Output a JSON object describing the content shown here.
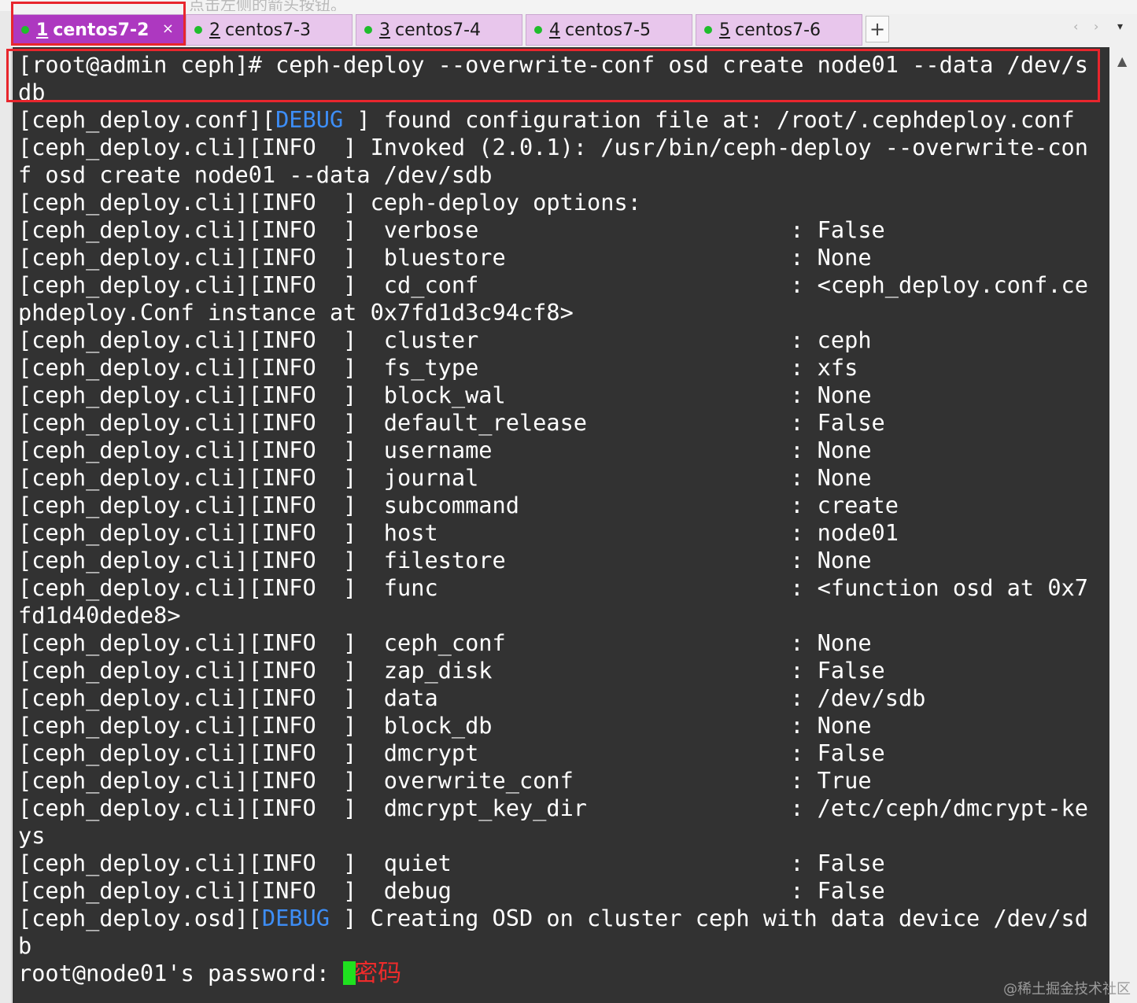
{
  "top_strip_text": "点击左侧的箭头按钮。",
  "tabs": [
    {
      "num": "1",
      "label": "centos7-2",
      "active": true
    },
    {
      "num": "2",
      "label": "centos7-3",
      "active": false
    },
    {
      "num": "3",
      "label": "centos7-4",
      "active": false
    },
    {
      "num": "4",
      "label": "centos7-5",
      "active": false
    },
    {
      "num": "5",
      "label": "centos7-6",
      "active": false
    }
  ],
  "tab_close_glyph": "×",
  "tab_add_glyph": "+",
  "nav_prev_glyph": "‹",
  "nav_next_glyph": "›",
  "menu_glyph": "▾",
  "scroll_up_glyph": "▲",
  "terminal": {
    "lines": [
      {
        "text": "[root@admin ceph]# ceph-deploy --overwrite-conf osd create node01 --data /dev/s"
      },
      {
        "text": "db"
      },
      {
        "prefix": "[ceph_deploy.conf][",
        "level": "DEBUG",
        "rest": " ] found configuration file at: /root/.cephdeploy.conf"
      },
      {
        "text": "[ceph_deploy.cli][INFO  ] Invoked (2.0.1): /usr/bin/ceph-deploy --overwrite-con"
      },
      {
        "text": "f osd create node01 --data /dev/sdb"
      },
      {
        "text": "[ceph_deploy.cli][INFO  ] ceph-deploy options:"
      },
      {
        "text": "[ceph_deploy.cli][INFO  ]  verbose                       : False"
      },
      {
        "text": "[ceph_deploy.cli][INFO  ]  bluestore                     : None"
      },
      {
        "text": "[ceph_deploy.cli][INFO  ]  cd_conf                       : <ceph_deploy.conf.ce"
      },
      {
        "text": "phdeploy.Conf instance at 0x7fd1d3c94cf8>"
      },
      {
        "text": "[ceph_deploy.cli][INFO  ]  cluster                       : ceph"
      },
      {
        "text": "[ceph_deploy.cli][INFO  ]  fs_type                       : xfs"
      },
      {
        "text": "[ceph_deploy.cli][INFO  ]  block_wal                     : None"
      },
      {
        "text": "[ceph_deploy.cli][INFO  ]  default_release               : False"
      },
      {
        "text": "[ceph_deploy.cli][INFO  ]  username                      : None"
      },
      {
        "text": "[ceph_deploy.cli][INFO  ]  journal                       : None"
      },
      {
        "text": "[ceph_deploy.cli][INFO  ]  subcommand                    : create"
      },
      {
        "text": "[ceph_deploy.cli][INFO  ]  host                          : node01"
      },
      {
        "text": "[ceph_deploy.cli][INFO  ]  filestore                     : None"
      },
      {
        "text": "[ceph_deploy.cli][INFO  ]  func                          : <function osd at 0x7"
      },
      {
        "text": "fd1d40dede8>"
      },
      {
        "text": "[ceph_deploy.cli][INFO  ]  ceph_conf                     : None"
      },
      {
        "text": "[ceph_deploy.cli][INFO  ]  zap_disk                      : False"
      },
      {
        "text": "[ceph_deploy.cli][INFO  ]  data                          : /dev/sdb"
      },
      {
        "text": "[ceph_deploy.cli][INFO  ]  block_db                      : None"
      },
      {
        "text": "[ceph_deploy.cli][INFO  ]  dmcrypt                       : False"
      },
      {
        "text": "[ceph_deploy.cli][INFO  ]  overwrite_conf                : True"
      },
      {
        "text": "[ceph_deploy.cli][INFO  ]  dmcrypt_key_dir               : /etc/ceph/dmcrypt-ke"
      },
      {
        "text": "ys"
      },
      {
        "text": "[ceph_deploy.cli][INFO  ]  quiet                         : False"
      },
      {
        "text": "[ceph_deploy.cli][INFO  ]  debug                         : False"
      },
      {
        "prefix": "[ceph_deploy.osd][",
        "level": "DEBUG",
        "rest": " ] Creating OSD on cluster ceph with data device /dev/sd"
      },
      {
        "text": "b"
      }
    ],
    "prompt": "root@node01's password: ",
    "annotation": "密码"
  },
  "watermark": "@稀土掘金技术社区",
  "colors": {
    "terminal_bg": "#323232",
    "debug_blue": "#3d8ef7",
    "cursor_green": "#1fe11f",
    "highlight_red": "#e8262d",
    "active_tab": "#ad38c0",
    "inactive_tab": "#e8c6ec",
    "status_dot": "#1fbd2c"
  }
}
